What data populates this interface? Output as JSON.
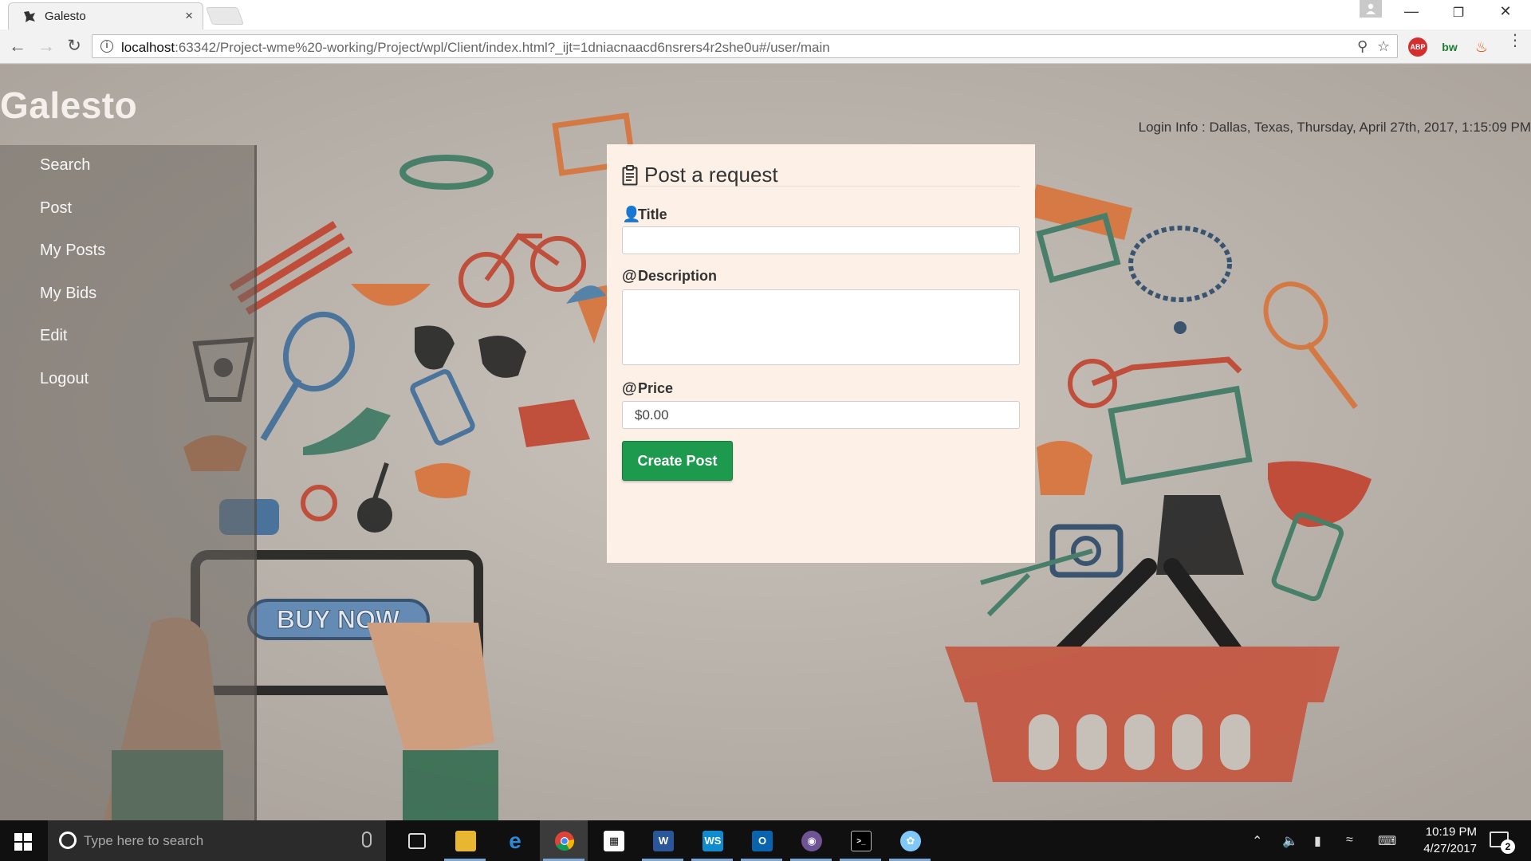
{
  "browser": {
    "tab_title": "Galesto",
    "tab_close": "×",
    "url_host": "localhost",
    "url_rest": ":63342/Project-wme%20-working/Project/wpl/Client/index.html?_ijt=1dniacnaacd6nsrers4r2she0u#/user/main",
    "ext_abp": "ABP",
    "ext_bw": "bw"
  },
  "app": {
    "brand": "Galesto",
    "login_info": "Login Info : Dallas, Texas, Thursday, April 27th, 2017, 1:15:09 PM"
  },
  "sidebar": {
    "items": [
      {
        "label": "Search"
      },
      {
        "label": "Post"
      },
      {
        "label": "My Posts"
      },
      {
        "label": "My Bids"
      },
      {
        "label": "Edit"
      },
      {
        "label": "Logout"
      }
    ]
  },
  "form": {
    "title": "Post a request",
    "title_label": "Title",
    "title_value": "",
    "description_label": "Description",
    "description_value": "",
    "price_label": "Price",
    "price_value": "$0.00",
    "submit_label": "Create Post"
  },
  "background_art": {
    "banner_text": "BUY NOW"
  },
  "taskbar": {
    "search_placeholder": "Type here to search",
    "time": "10:19 PM",
    "date": "4/27/2017",
    "notification_count": "2",
    "apps": [
      "task-view",
      "file-explorer",
      "edge",
      "chrome",
      "store",
      "word",
      "webstorm",
      "outlook",
      "github",
      "terminal",
      "paint"
    ]
  }
}
